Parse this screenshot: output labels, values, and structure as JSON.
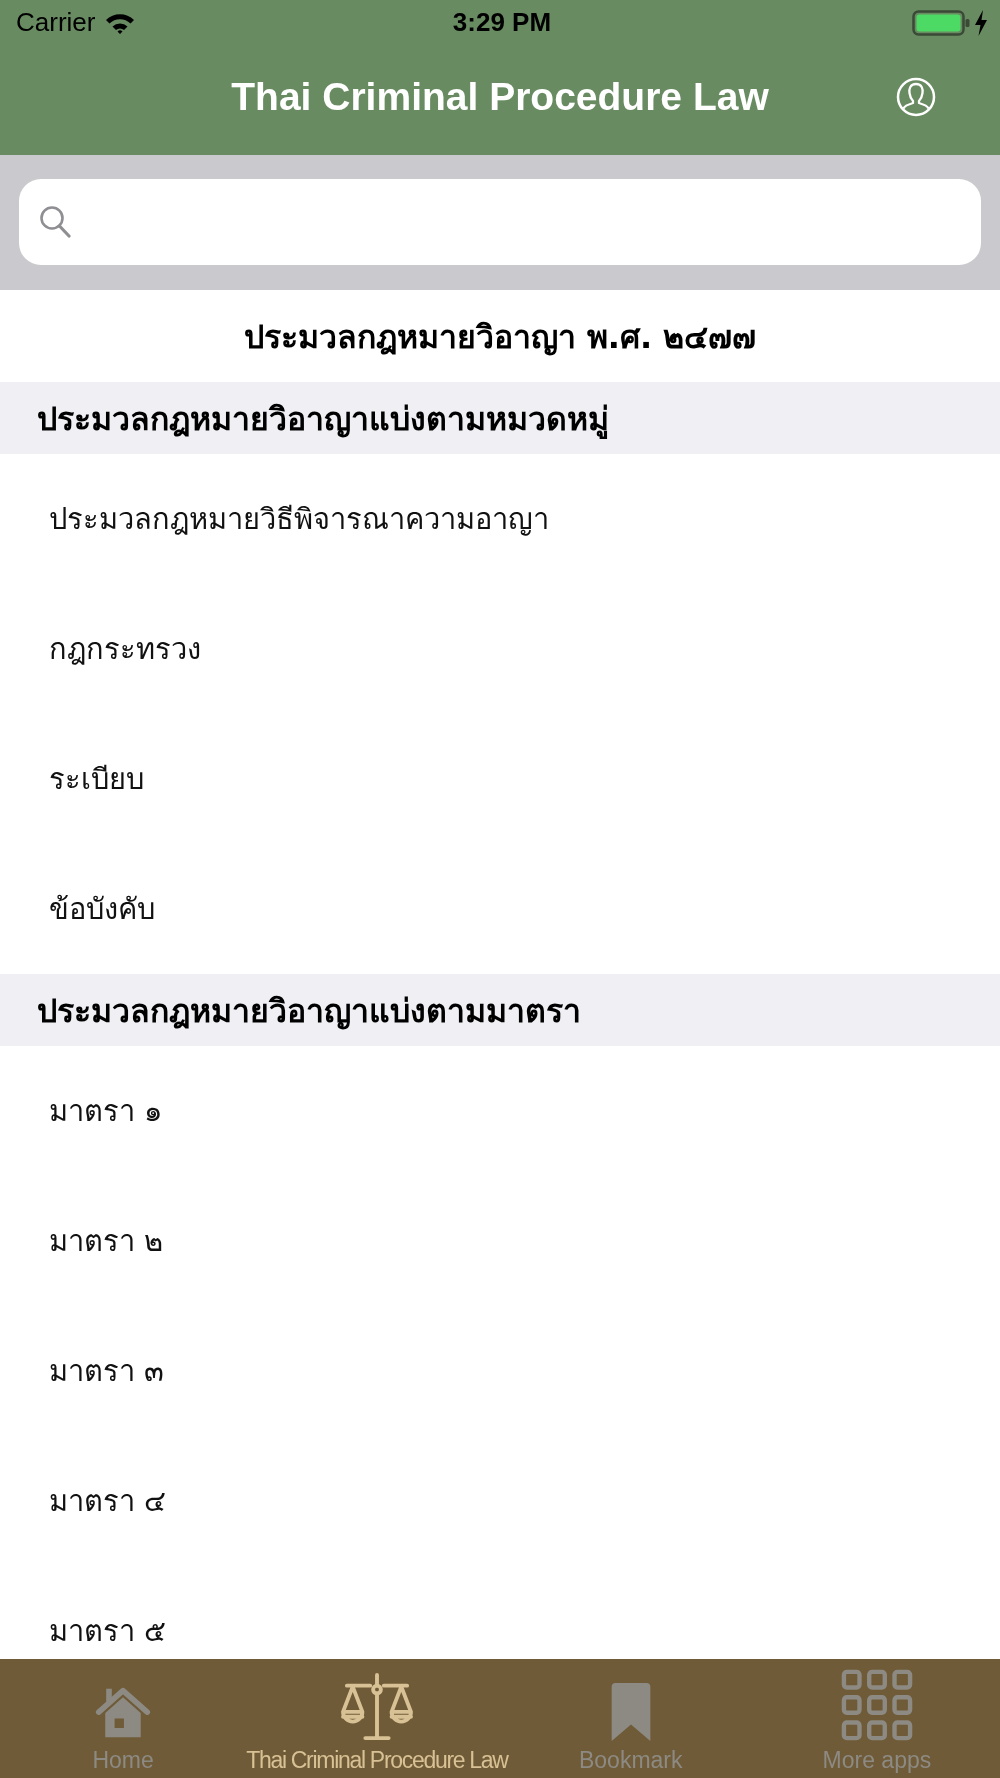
{
  "status_bar": {
    "carrier": "Carrier",
    "time": "3:29 PM"
  },
  "nav_bar": {
    "title": "Thai Criminal Procedure Law"
  },
  "book_title": "ประมวลกฎหมายวิอาญา พ.ศ. ๒๔๗๗",
  "sections": [
    {
      "header": "ประมวลกฎหมายวิอาญาแบ่งตามหมวดหมู่",
      "items": [
        "ประมวลกฎหมายวิธีพิจารณาความอาญา",
        "กฎกระทรวง",
        "ระเบียบ",
        "ข้อบังคับ"
      ]
    },
    {
      "header": "ประมวลกฎหมายวิอาญาแบ่งตามมาตรา",
      "items": [
        "มาตรา ๑",
        "มาตรา ๒",
        "มาตรา ๓",
        "มาตรา ๔",
        "มาตรา ๕"
      ]
    }
  ],
  "tab_bar": {
    "tabs": [
      {
        "label": "Home",
        "selected": false
      },
      {
        "label": "Thai Criminal Procedure Law",
        "selected": true
      },
      {
        "label": "Bookmark",
        "selected": false
      },
      {
        "label": "More apps",
        "selected": false
      }
    ]
  }
}
